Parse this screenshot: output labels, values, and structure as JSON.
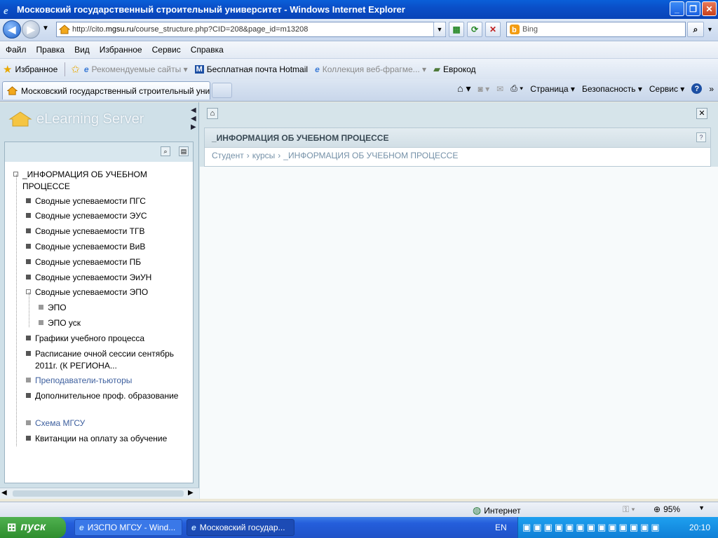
{
  "window": {
    "title": "Московский государственный строительный университет - Windows Internet Explorer"
  },
  "address": {
    "prefix": "http://cito.",
    "host": "mgsu.ru",
    "path": "/course_structure.php?CID=208&page_id=m13208"
  },
  "search": {
    "placeholder": "Bing"
  },
  "menu": [
    "Файл",
    "Правка",
    "Вид",
    "Избранное",
    "Сервис",
    "Справка"
  ],
  "favorites": {
    "label": "Избранное",
    "items": [
      {
        "label": "Рекомендуемые сайты ▾"
      },
      {
        "label": "Бесплатная почта Hotmail"
      },
      {
        "label": "Коллекция веб-фрагме... ▾"
      },
      {
        "label": "Еврокод"
      }
    ]
  },
  "tabs": [
    {
      "label": "Московский государственный строительный унив..."
    }
  ],
  "commandbar": {
    "page": "Страница ▾",
    "safety": "Безопасность ▾",
    "tools": "Сервис ▾"
  },
  "logo": {
    "text": "eLearning Server"
  },
  "tree": [
    {
      "label": "_ИНФОРМАЦИЯ ОБ УЧЕБНОМ ПРОЦЕССЕ",
      "style": "open"
    },
    {
      "label": "Сводные успеваемости ПГС",
      "style": "leaf"
    },
    {
      "label": "Сводные успеваемости ЭУС",
      "style": "leaf"
    },
    {
      "label": "Сводные успеваемости ТГВ",
      "style": "leaf"
    },
    {
      "label": "Сводные успеваемости ВиВ",
      "style": "leaf"
    },
    {
      "label": "Сводные успеваемости ПБ",
      "style": "leaf"
    },
    {
      "label": "Сводные успеваемости ЭиУН",
      "style": "leaf"
    },
    {
      "label": "Сводные успеваемости ЭПО",
      "style": "open"
    },
    {
      "label": "ЭПО",
      "style": "dim"
    },
    {
      "label": "ЭПО уск",
      "style": "dim"
    },
    {
      "label": "Графики учебного процесса",
      "style": "leaf"
    },
    {
      "label": "Расписание очной сессии сентябрь 2011г. (К РЕГИОНА...",
      "style": "leaf"
    },
    {
      "label": "Преподаватели-тьюторы",
      "style": "dimblue"
    },
    {
      "label": "Дополнительное проф. образование",
      "style": "leaf"
    },
    {
      "label": "Схема МГСУ",
      "style": "dimblue"
    },
    {
      "label": "Квитанции на оплату за обучение",
      "style": "leaf"
    }
  ],
  "panel": {
    "title": "_ИНФОРМАЦИЯ ОБ УЧЕБНОМ ПРОЦЕССЕ",
    "breadcrumb": [
      "Студент",
      "›",
      "курсы",
      "›",
      "_ИНФОРМАЦИЯ ОБ УЧЕБНОМ ПРОЦЕССЕ"
    ]
  },
  "status": {
    "zone": "Интернет",
    "zoom": "95%"
  },
  "taskbar": {
    "start": "пуск",
    "tasks": [
      {
        "label": "ИЗСПО МГСУ - Wind..."
      },
      {
        "label": "Московский государ..."
      }
    ],
    "lang": "EN",
    "clock": "20:10"
  }
}
